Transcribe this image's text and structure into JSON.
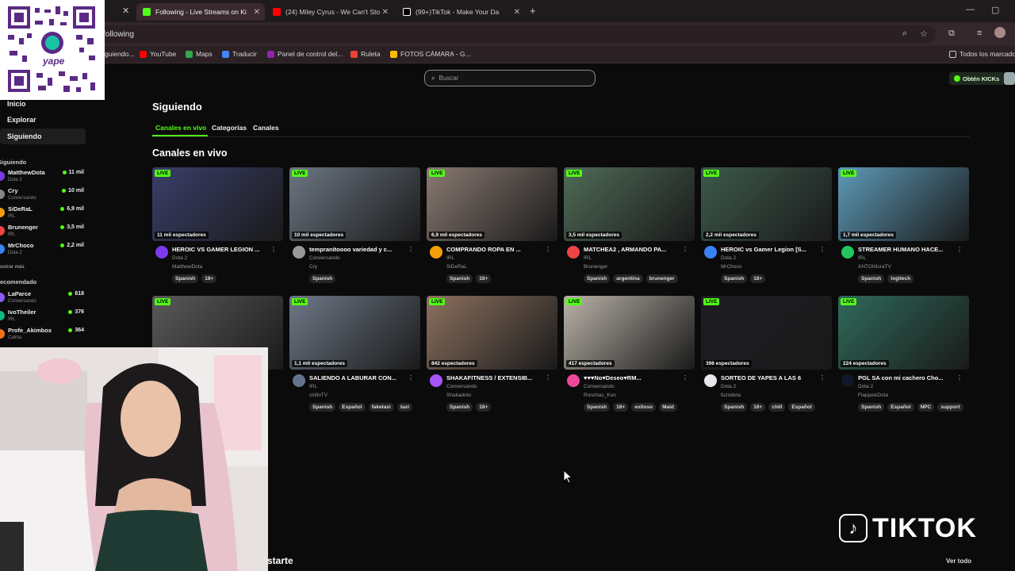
{
  "browser": {
    "tabs": [
      {
        "title": "Following - Live Streams on Ki",
        "color": "#53fc18",
        "active": true
      },
      {
        "title": "(24) Miley Cyrus - We Can't Sto",
        "color": "#ff0000",
        "active": false
      },
      {
        "title": "(99+)TikTok - Make Your Da",
        "color": "#111111",
        "active": false
      }
    ],
    "url": "following",
    "bookmarks": [
      {
        "label": "guiendo...",
        "color": "#53fc18"
      },
      {
        "label": "YouTube",
        "color": "#ff0000"
      },
      {
        "label": "Maps",
        "color": "#34a853"
      },
      {
        "label": "Traducir",
        "color": "#4285f4"
      },
      {
        "label": "Panel de control del...",
        "color": "#8e24aa"
      },
      {
        "label": "Ruleta",
        "color": "#ea4335"
      },
      {
        "label": "FOTOS CÁMARA - G...",
        "color": "#fbbc05"
      }
    ],
    "all_bookmarks": "Todos los marcado"
  },
  "header": {
    "search_placeholder": "Buscar",
    "kicks_label": "Obtén KICKs"
  },
  "sidebar": {
    "nav": [
      {
        "label": "Inicio"
      },
      {
        "label": "Explorar"
      },
      {
        "label": "Siguiendo"
      }
    ],
    "following_title": "Siguiendo",
    "following": [
      {
        "name": "MatthewDota",
        "sub": "Dota 2",
        "viewers": "11 mil",
        "color": "#7c3aed"
      },
      {
        "name": "Cry",
        "sub": "Conversando",
        "viewers": "10 mil",
        "color": "#888888"
      },
      {
        "name": "SiDeRaL",
        "sub": "IRL",
        "viewers": "6,9 mil",
        "color": "#f59e0b"
      },
      {
        "name": "Brunenger",
        "sub": "IRL",
        "viewers": "3,5 mil",
        "color": "#ef4444"
      },
      {
        "name": "MrChoco",
        "sub": "Dota 2",
        "viewers": "2,2 mil",
        "color": "#3b82f6"
      }
    ],
    "show_more": "ostrar más",
    "recommended_title": "ecomendado",
    "recommended": [
      {
        "name": "LaParce",
        "sub": "Conversando",
        "viewers": "618",
        "color": "#8b5cf6"
      },
      {
        "name": "IvoTheiler",
        "sub": "IRL",
        "viewers": "376",
        "color": "#10b981"
      },
      {
        "name": "Profe_Akimbox",
        "sub": "Calma",
        "viewers": "364",
        "color": "#f97316"
      }
    ]
  },
  "main": {
    "title": "Siguiendo",
    "tabs": [
      "Canales en vivo",
      "Categorías",
      "Canales"
    ],
    "section_title": "Canales en vivo",
    "live_label": "LIVE",
    "streams": [
      {
        "title": "HEROIC VS GAMER LEGION ...",
        "category": "Dota 2",
        "user": "MatthewDota",
        "viewers": "11 mil espectadores",
        "tags": [
          "Spanish",
          "18+"
        ],
        "thumb": "#3a3f6a",
        "avatar": "#7c3aed"
      },
      {
        "title": "tempranitoooo variedad y c...",
        "category": "Conversando",
        "user": "Cry",
        "viewers": "10 mil espectadores",
        "tags": [
          "Spanish"
        ],
        "thumb": "#6b7683",
        "avatar": "#999999"
      },
      {
        "title": "COMPRANDO ROPA EN ...",
        "category": "IRL",
        "user": "SiDeRaL",
        "viewers": "6,9 mil espectadores",
        "tags": [
          "Spanish",
          "18+"
        ],
        "thumb": "#8a7a72",
        "avatar": "#f59e0b"
      },
      {
        "title": "MATCHEA2 , ARMANDO PA...",
        "category": "IRL",
        "user": "Brunenger",
        "viewers": "3,5 mil espectadores",
        "tags": [
          "Spanish",
          "argentina",
          "brunenger"
        ],
        "thumb": "#4f6b57",
        "avatar": "#ef4444"
      },
      {
        "title": "HEROIC vs Gamer Legion [S...",
        "category": "Dota 2",
        "user": "MrChoco",
        "viewers": "2,2 mil espectadores",
        "tags": [
          "Spanish",
          "18+"
        ],
        "thumb": "#3d5a4c",
        "avatar": "#3b82f6"
      },
      {
        "title": "STREAMER HUMANO HACE...",
        "category": "IRL",
        "user": "ANTONIcraTV",
        "viewers": "1,7 mil espectadores",
        "tags": [
          "Spanish",
          "logitech"
        ],
        "thumb": "#5d9ab8",
        "avatar": "#22c55e"
      },
      {
        "title": "",
        "category": "",
        "user": "",
        "viewers": "",
        "tags": [],
        "thumb": "#5a5a5a",
        "avatar": "#444444"
      },
      {
        "title": "SALIENDO A LABURAR CON...",
        "category": "IRL",
        "user": "cirilloTV",
        "viewers": "1,1 mil espectadores",
        "tags": [
          "Spanish",
          "Español",
          "faketaxi",
          "taxi"
        ],
        "thumb": "#6e7887",
        "avatar": "#64748b"
      },
      {
        "title": "SHAKAFITNESS / EXTENSIB...",
        "category": "Conversando",
        "user": "Shakadoto",
        "viewers": "842 espectadores",
        "tags": [
          "Spanish",
          "18+"
        ],
        "thumb": "#8d7160",
        "avatar": "#a855f7"
      },
      {
        "title": "♥♥♥No♥Deseo♥RM...",
        "category": "Conversando",
        "user": "Ronchas_Kun",
        "viewers": "417 espectadores",
        "tags": [
          "Spanish",
          "18+",
          "exitoso",
          "Maid"
        ],
        "thumb": "#b9b2a8",
        "avatar": "#ec4899"
      },
      {
        "title": "SORTEO DE YAPES A LAS 6",
        "category": "Dota 2",
        "user": "fuzodota",
        "viewers": "398 espectadores",
        "tags": [
          "Spanish",
          "18+",
          "chill",
          "Español"
        ],
        "thumb": "#1d1d22",
        "avatar": "#e5e7eb"
      },
      {
        "title": "PGL SA con mi cachero Cho...",
        "category": "Dota 2",
        "user": "FlapjackDota",
        "viewers": "224 espectadores",
        "tags": [
          "Spanish",
          "Español",
          "NPC",
          "support"
        ],
        "thumb": "#2f6a5a",
        "avatar": "#111827"
      }
    ],
    "footer_left": "starte",
    "footer_right": "Ver todo"
  },
  "overlays": {
    "qr_caption": "yape",
    "tiktok_text": "TIKTOK"
  }
}
